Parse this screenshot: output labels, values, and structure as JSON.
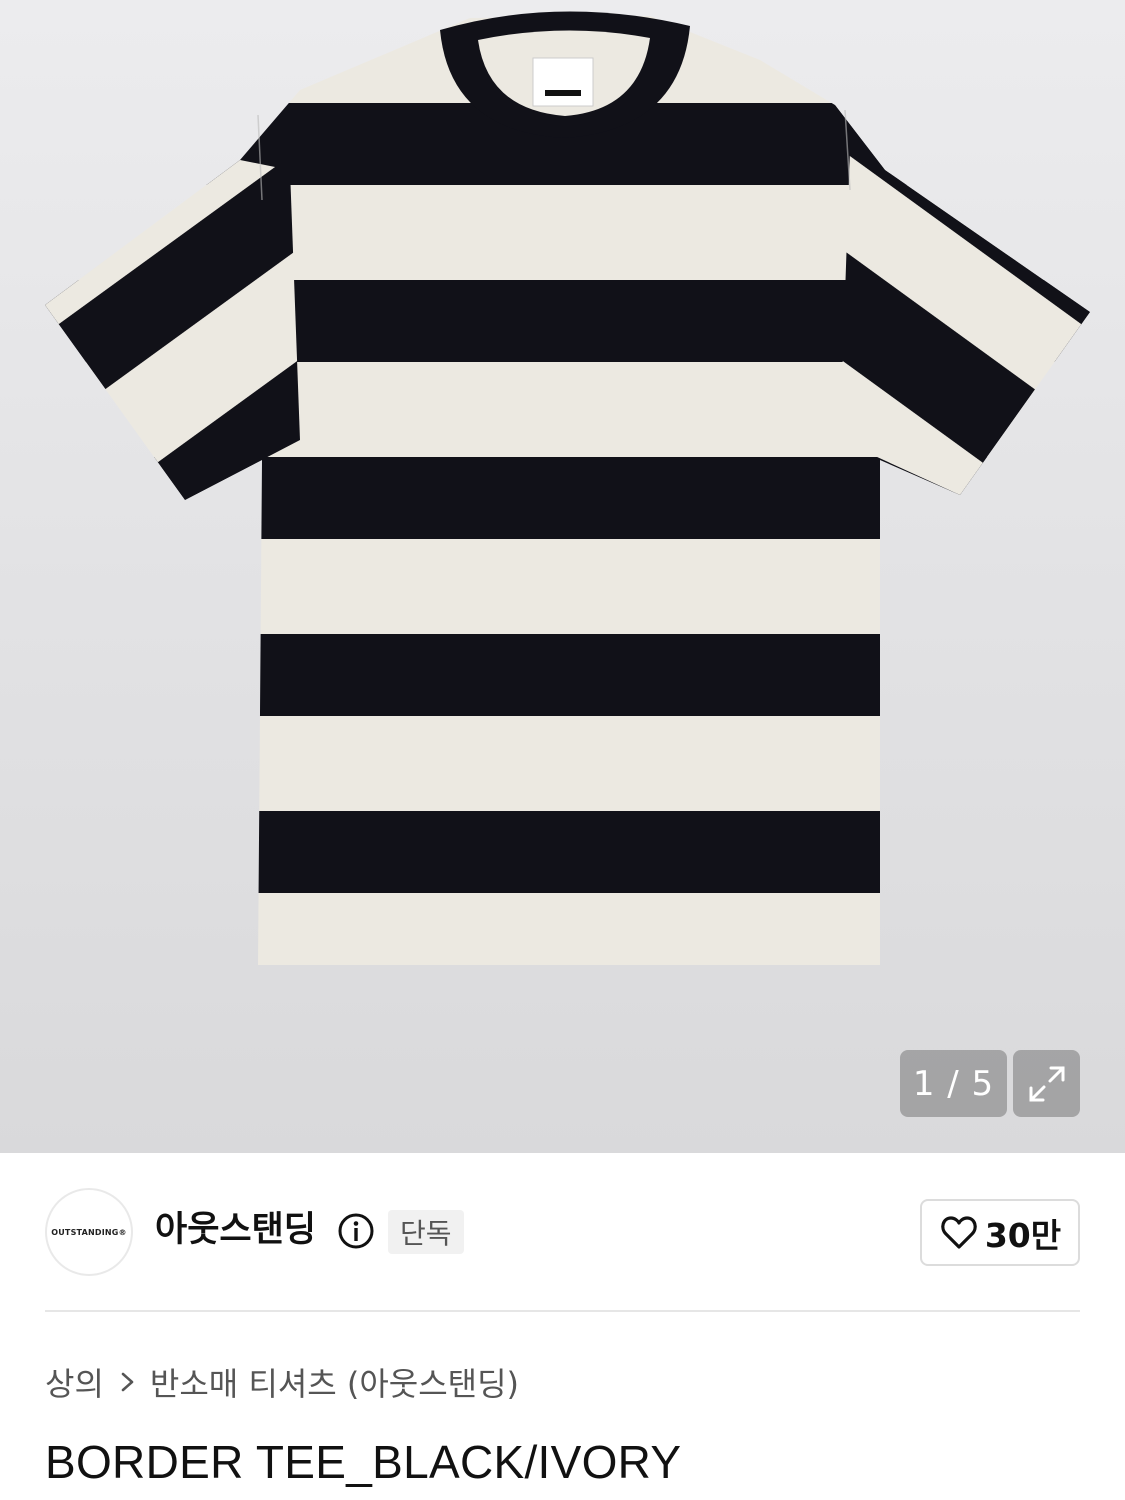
{
  "gallery": {
    "counter": "1 / 5",
    "image_label_brand": "OUTSTANDING",
    "colors": {
      "stripe_dark": "#111118",
      "stripe_light": "#ece9e1"
    }
  },
  "brand": {
    "logo_text": "OUTSTANDING®",
    "name": "아웃스탠딩",
    "badge": "단독"
  },
  "like": {
    "count": "30만"
  },
  "breadcrumb": {
    "level1": "상의",
    "level2": "반소매 티셔츠 (아웃스탠딩)"
  },
  "product": {
    "title": "BORDER TEE_BLACK/IVORY"
  }
}
